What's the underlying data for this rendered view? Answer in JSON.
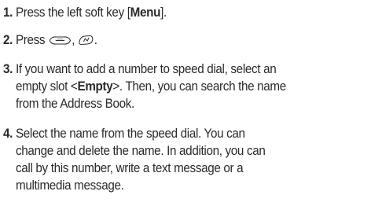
{
  "steps": [
    {
      "number": "1.",
      "before": "Press the left soft key [",
      "bold": "Menu",
      "after": "]."
    },
    {
      "number": "2.",
      "before": "Press",
      "separator": ",",
      "end": ".",
      "icons": [
        "menu-key-icon",
        "keypad-key-icon"
      ]
    },
    {
      "number": "3.",
      "line1_before": "If you want to add a number to speed dial, select an",
      "line2_before": "empty slot <",
      "bold": "Empty",
      "line2_after": ">. Then, you can search the name",
      "line3": "from the Address Book."
    },
    {
      "number": "4.",
      "line1": "Select the name from the speed dial. You can",
      "line2": "change and delete the name. In addition, you can",
      "line3": "call by this number, write a text message or a",
      "line4": "multimedia message."
    }
  ]
}
